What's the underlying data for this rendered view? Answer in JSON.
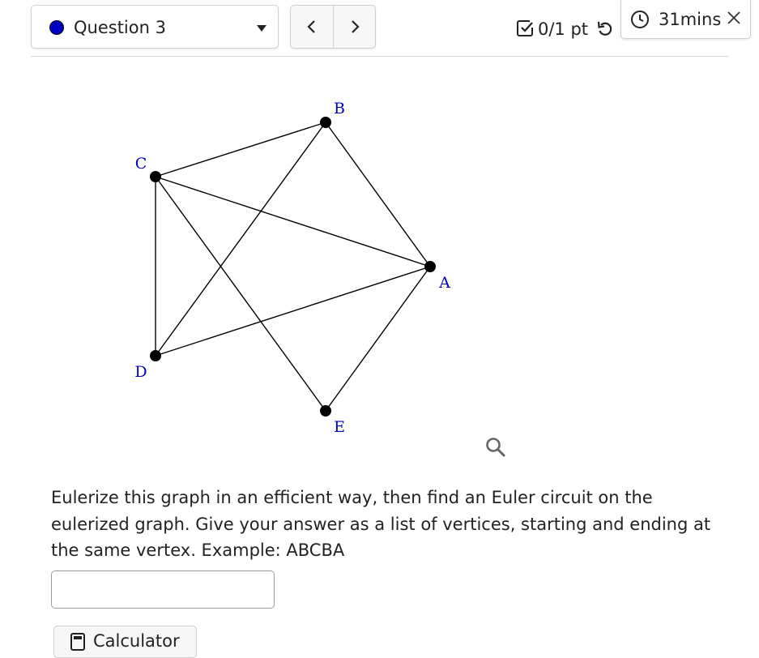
{
  "header": {
    "question_selector": {
      "label": "Question 3",
      "status_color": "#0000c0"
    },
    "nav": {
      "prev_icon": "chevron-left-icon",
      "next_icon": "chevron-right-icon"
    },
    "score": {
      "text": "0/1 pt",
      "icon": "checkbox-check-icon"
    },
    "retry_icon": "retry-icon",
    "timer": {
      "text": "31mins",
      "icon": "clock-icon",
      "close_icon": "close-icon"
    }
  },
  "graph": {
    "vertices": [
      {
        "id": "A",
        "label": "A"
      },
      {
        "id": "B",
        "label": "B"
      },
      {
        "id": "C",
        "label": "C"
      },
      {
        "id": "D",
        "label": "D"
      },
      {
        "id": "E",
        "label": "E"
      }
    ],
    "edges": [
      [
        "C",
        "B"
      ],
      [
        "C",
        "A"
      ],
      [
        "C",
        "D"
      ],
      [
        "C",
        "E"
      ],
      [
        "B",
        "A"
      ],
      [
        "B",
        "D"
      ],
      [
        "D",
        "A"
      ],
      [
        "A",
        "E"
      ]
    ],
    "label_color": "#0000c0",
    "edge_color": "#000000"
  },
  "zoom_icon": "magnifier-icon",
  "question": {
    "text": "Eulerize this graph in an efficient way, then find an Euler circuit on the eulerized graph. Give your answer as a list of vertices, starting and ending at the same vertex. Example: ABCBA"
  },
  "answer": {
    "value": "",
    "placeholder": ""
  },
  "calculator": {
    "label": "Calculator",
    "icon": "calculator-icon"
  }
}
